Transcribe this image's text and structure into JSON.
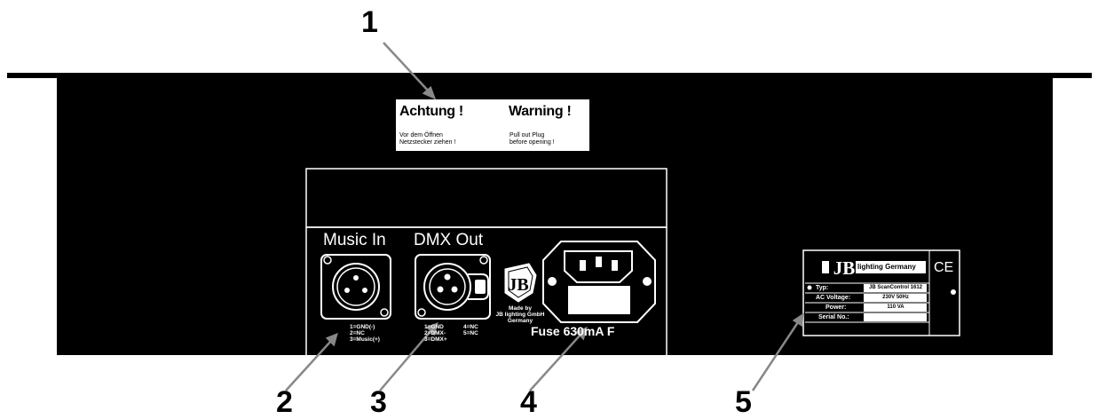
{
  "callouts": {
    "c1": "1",
    "c2": "2",
    "c3": "3",
    "c4": "4",
    "c5": "5"
  },
  "warning_label": {
    "left_title": "Achtung !",
    "right_title": "Warning !",
    "left_line1": "Vor dem Öffnen",
    "left_line2": "Netzstecker ziehen !",
    "right_line1": "Pull out Plug",
    "right_line2": "before opening !"
  },
  "connectors": {
    "music_in_label": "Music In",
    "dmx_out_label": "DMX Out",
    "music_pins": [
      "1=GND(-)",
      "2=NC",
      "3=Music(+)"
    ],
    "dmx_pins_left": [
      "1=GND",
      "2=DMX-",
      "3=DMX+"
    ],
    "dmx_pins_right": [
      "4=NC",
      "5=NC"
    ]
  },
  "maker": {
    "line1": "Made by",
    "line2": "JB lighting GmbH",
    "line3": "Germany"
  },
  "fuse": {
    "label": "Fuse 630mA F"
  },
  "type_plate": {
    "brand": "lighting Germany",
    "ce_mark": "CE",
    "rows": [
      {
        "label": "Typ:",
        "value": "JB ScanControl 1612"
      },
      {
        "label": "AC Voltage:",
        "value": "230V 50Hz"
      },
      {
        "label": "Power:",
        "value": "110 VA"
      },
      {
        "label": "Serial No.:",
        "value": ""
      }
    ]
  }
}
